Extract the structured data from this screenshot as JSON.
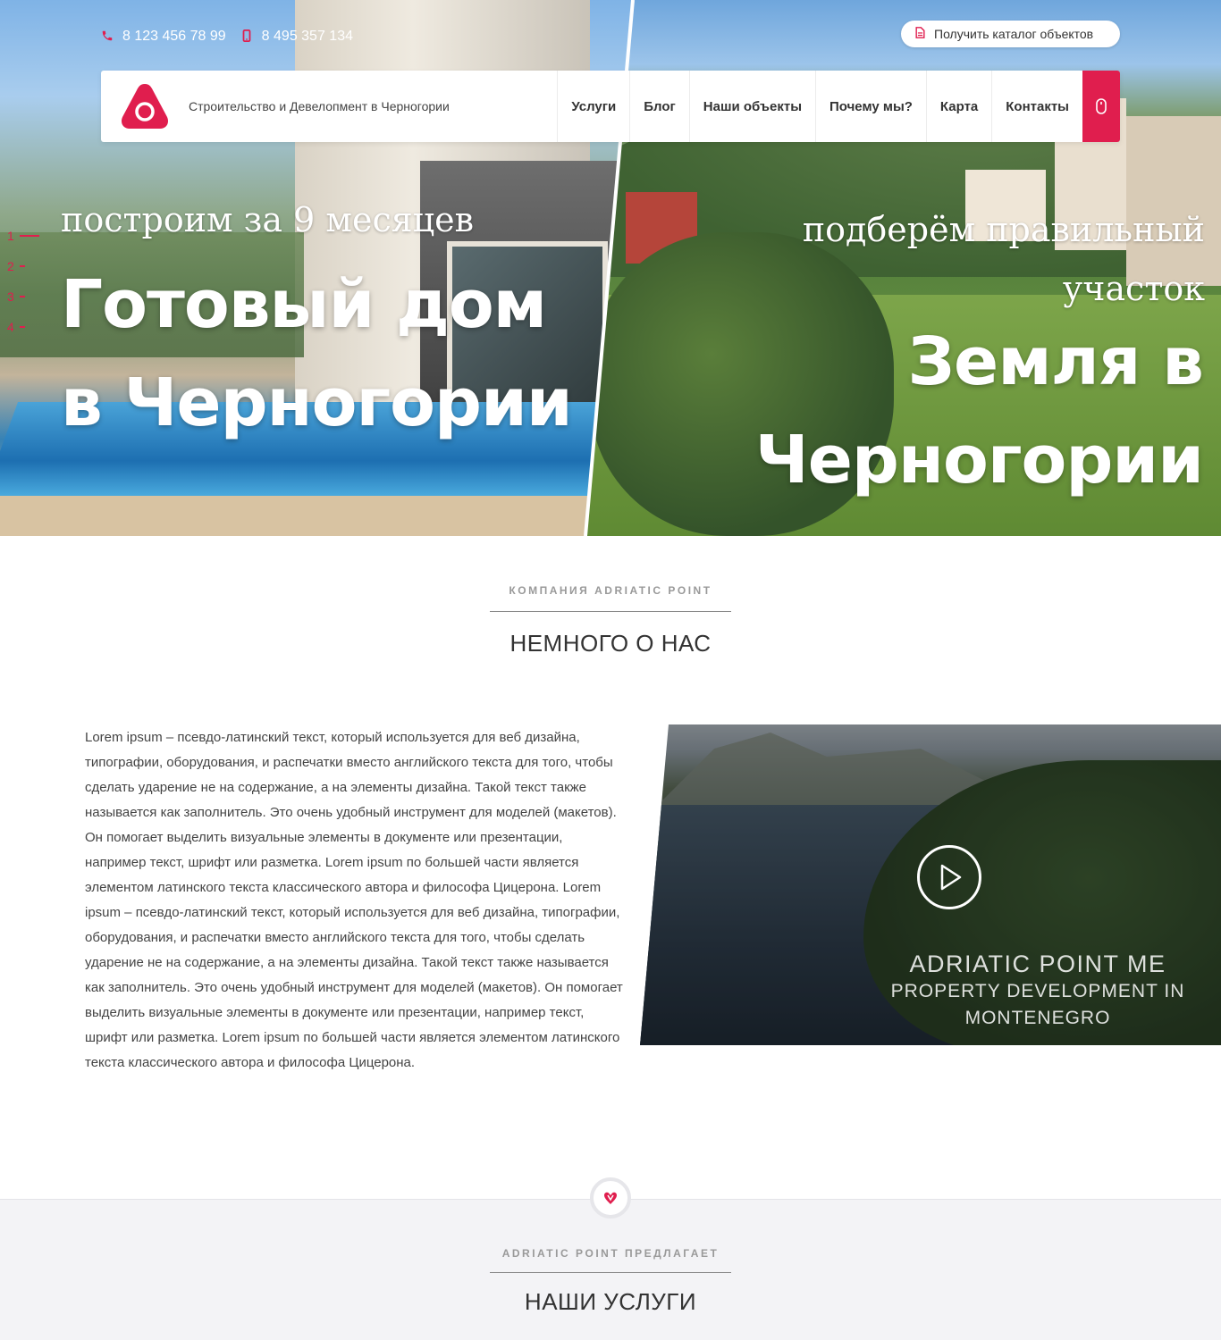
{
  "topbar": {
    "phone1": "8 123 456 78 99",
    "phone1_icon": "phone-icon",
    "phone2": "8 495 357 134",
    "phone2_icon": "mobile-icon",
    "catalog_button": "Получить каталог объектов",
    "catalog_icon": "document-icon"
  },
  "header": {
    "logo_icon": "adriatic-point-logo",
    "tagline": "Строительство и Девелопмент в Черногории",
    "nav": [
      "Услуги",
      "Блог",
      "Наши объекты",
      "Почему мы?",
      "Карта",
      "Контакты"
    ],
    "cta_icon": "mouse-icon"
  },
  "hero": {
    "slides": [
      "1",
      "2",
      "3",
      "4"
    ],
    "active_slide": 1,
    "left_subtitle": "построим за 9 месяцев",
    "left_title": "Готовый дом в Черногории",
    "right_subtitle": "подберём правильный участок",
    "right_title": "Земля в Черногории"
  },
  "about": {
    "kicker": "КОМПАНИЯ ADRIATIC POINT",
    "title": "НЕМНОГО О НАС",
    "text": "Lorem ipsum – псевдо-латинский текст, который используется для веб дизайна, типографии, оборудования, и распечатки вместо английского текста для того, чтобы сделать ударение не на содержание, а на элементы дизайна. Такой текст также называется как заполнитель. Это очень удобный инструмент для моделей (макетов). Он помогает выделить визуальные элементы в документе или презентации, например текст, шрифт или разметка. Lorem ipsum по большей части является элементом латинского текста классического автора и философа Цицерона. Lorem ipsum – псевдо-латинский текст, который используется для веб дизайна, типографии, оборудования, и распечатки вместо английского текста для того, чтобы сделать ударение не на содержание, а на элементы дизайна. Такой текст также называется как заполнитель. Это очень удобный инструмент для моделей (макетов). Он помогает выделить визуальные элементы в документе или презентации, например текст, шрифт или разметка. Lorem ipsum по большей части является элементом латинского текста классического автора и философа Цицерона.",
    "video_caption_line1": "ADRIATIC POINT ME",
    "video_caption_line2": "PROPERTY DEVELOPMENT IN MONTENEGRO",
    "play_icon": "play-icon"
  },
  "services": {
    "badge_icon": "heart-logo-icon",
    "kicker": "ADRIATIC POINT ПРЕДЛАГАЕТ",
    "title": "НАШИ УСЛУГИ"
  },
  "colors": {
    "accent": "#e01e4e",
    "text": "#333333",
    "muted": "#999999",
    "services_bg": "#f3f3f6"
  }
}
